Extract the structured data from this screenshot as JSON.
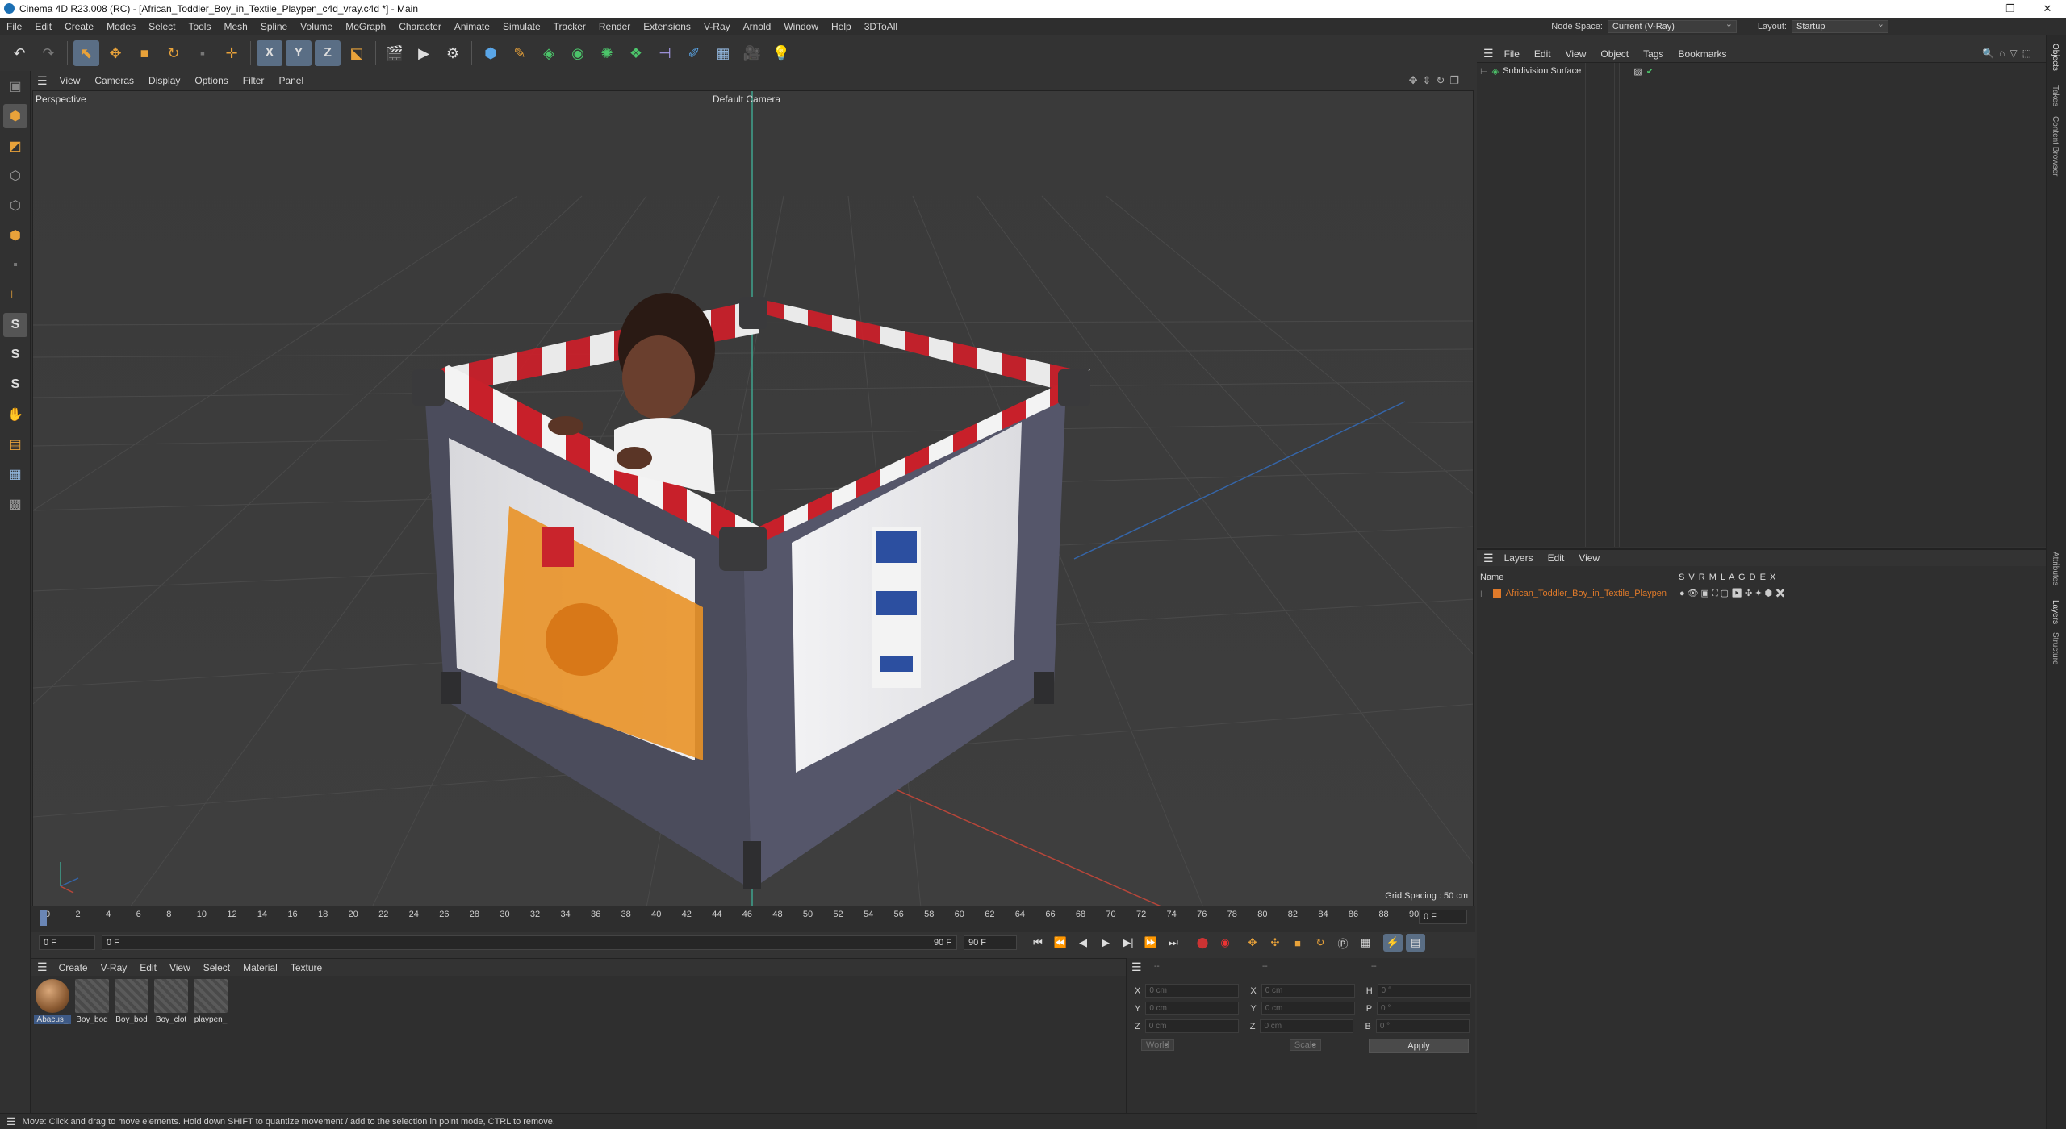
{
  "window": {
    "title": "Cinema 4D R23.008 (RC) - [African_Toddler_Boy_in_Textile_Playpen_c4d_vray.c4d *] - Main"
  },
  "menu": [
    "File",
    "Edit",
    "Create",
    "Modes",
    "Select",
    "Tools",
    "Mesh",
    "Spline",
    "Volume",
    "MoGraph",
    "Character",
    "Animate",
    "Simulate",
    "Tracker",
    "Render",
    "Extensions",
    "V-Ray",
    "Arnold",
    "Window",
    "Help",
    "3DToAll"
  ],
  "nodespace": {
    "label": "Node Space:",
    "value": "Current (V-Ray)"
  },
  "layout": {
    "label": "Layout:",
    "value": "Startup"
  },
  "toolbar": {
    "axis_x": "X",
    "axis_y": "Y",
    "axis_z": "Z"
  },
  "viewport": {
    "menu": [
      "View",
      "Cameras",
      "Display",
      "Options",
      "Filter",
      "Panel"
    ],
    "label": "Perspective",
    "camera": "Default Camera",
    "grid_spacing": "Grid Spacing : 50 cm"
  },
  "timeline": {
    "ticks": [
      "0",
      "2",
      "4",
      "6",
      "8",
      "10",
      "12",
      "14",
      "16",
      "18",
      "20",
      "22",
      "24",
      "26",
      "28",
      "30",
      "32",
      "34",
      "36",
      "38",
      "40",
      "42",
      "44",
      "46",
      "48",
      "50",
      "52",
      "54",
      "56",
      "58",
      "60",
      "62",
      "64",
      "66",
      "68",
      "70",
      "72",
      "74",
      "76",
      "78",
      "80",
      "82",
      "84",
      "86",
      "88",
      "90"
    ],
    "current_frame": "0 F",
    "start_field": "0 F",
    "range_start": "0 F",
    "range_end": "90 F",
    "end_field": "90 F"
  },
  "materials": {
    "menu": [
      "Create",
      "V-Ray",
      "Edit",
      "View",
      "Select",
      "Material",
      "Texture"
    ],
    "items": [
      {
        "label": "Abacus_"
      },
      {
        "label": "Boy_bod"
      },
      {
        "label": "Boy_bod"
      },
      {
        "label": "Boy_clot"
      },
      {
        "label": "playpen_"
      }
    ]
  },
  "coords": {
    "header": [
      "--",
      "--",
      "--"
    ],
    "rows": [
      {
        "a": "X",
        "av": "0 cm",
        "b": "X",
        "bv": "0 cm",
        "c": "H",
        "cv": "0 °"
      },
      {
        "a": "Y",
        "av": "0 cm",
        "b": "Y",
        "bv": "0 cm",
        "c": "P",
        "cv": "0 °"
      },
      {
        "a": "Z",
        "av": "0 cm",
        "b": "Z",
        "bv": "0 cm",
        "c": "B",
        "cv": "0 °"
      }
    ],
    "world": "World",
    "scale": "Scale",
    "apply": "Apply"
  },
  "objects": {
    "menu": [
      "File",
      "Edit",
      "View",
      "Object",
      "Tags",
      "Bookmarks"
    ],
    "items": [
      {
        "name": "Subdivision Surface"
      }
    ]
  },
  "layers": {
    "menu": [
      "Layers",
      "Edit",
      "View"
    ],
    "col_name": "Name",
    "col_flags": "S  V  R  M  L  A  G  D  E  X",
    "items": [
      {
        "name": "African_Toddler_Boy_in_Textile_Playpen",
        "color": "#e07a2a"
      }
    ]
  },
  "sidetabs": [
    "Objects",
    "Takes",
    "Content Browser",
    "Attributes",
    "Layers",
    "Structure"
  ],
  "status": {
    "text": "Move: Click and drag to move elements. Hold down SHIFT to quantize movement / add to the selection in point mode, CTRL to remove."
  },
  "colors": {
    "accent": "#5a6e85",
    "orange": "#e8a23a",
    "layer": "#e07a2a"
  }
}
